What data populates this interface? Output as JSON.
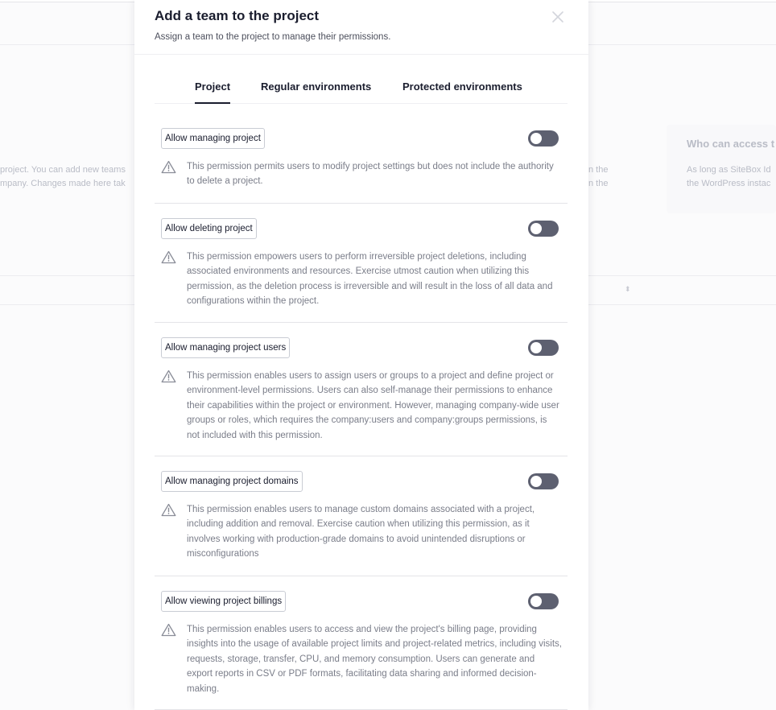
{
  "background": {
    "left_text_line1": "project. You can add new teams",
    "left_text_line2": "mpany. Changes made here tak",
    "mid_text_line1": "n the",
    "mid_text_line2": "n the",
    "right_heading": "Who can access t",
    "right_text_line1": "As long as SiteBox Id",
    "right_text_line2": "the WordPress instac",
    "sort_glyph": "⬍"
  },
  "modal": {
    "title": "Add a team to the project",
    "subtitle": "Assign a team to the project to manage their permissions.",
    "tabs": [
      {
        "label": "Project",
        "active": true
      },
      {
        "label": "Regular environments",
        "active": false
      },
      {
        "label": "Protected environments",
        "active": false
      }
    ],
    "permissions": [
      {
        "label": "Allow managing project",
        "enabled": false,
        "description": "This permission permits users to modify project settings but does not include the authority to delete a project."
      },
      {
        "label": "Allow deleting project",
        "enabled": false,
        "description": "This permission empowers users to perform irreversible project deletions, including associated environments and resources. Exercise utmost caution when utilizing this permission, as the deletion process is irreversible and will result in the loss of all data and configurations within the project."
      },
      {
        "label": "Allow managing project users",
        "enabled": false,
        "description": "This permission enables users to assign users or groups to a project and define project or environment-level permissions. Users can also self-manage their permissions to enhance their capabilities within the project or environment. However, managing company-wide user groups or roles, which requires the company:users and company:groups permissions, is not included with this permission."
      },
      {
        "label": "Allow managing project domains",
        "enabled": false,
        "description": "This permission enables users to manage custom domains associated with a project, including addition and removal. Exercise caution when utilizing this permission, as it involves working with production-grade domains to avoid unintended disruptions or misconfigurations"
      },
      {
        "label": "Allow viewing project billings",
        "enabled": false,
        "description": "This permission enables users to access and view the project's billing page, providing insights into the usage of available project limits and project-related metrics, including visits, requests, storage, transfer, CPU, and memory consumption. Users can generate and export reports in CSV or PDF formats, facilitating data sharing and informed decision-making."
      }
    ]
  },
  "colors": {
    "toggle_off": "#5d6070",
    "title": "#1a1d2e",
    "description": "#7a7d89",
    "warning_icon": "#8a8d98"
  },
  "icons": {
    "close": "close-icon",
    "warning": "warning-triangle-icon"
  }
}
